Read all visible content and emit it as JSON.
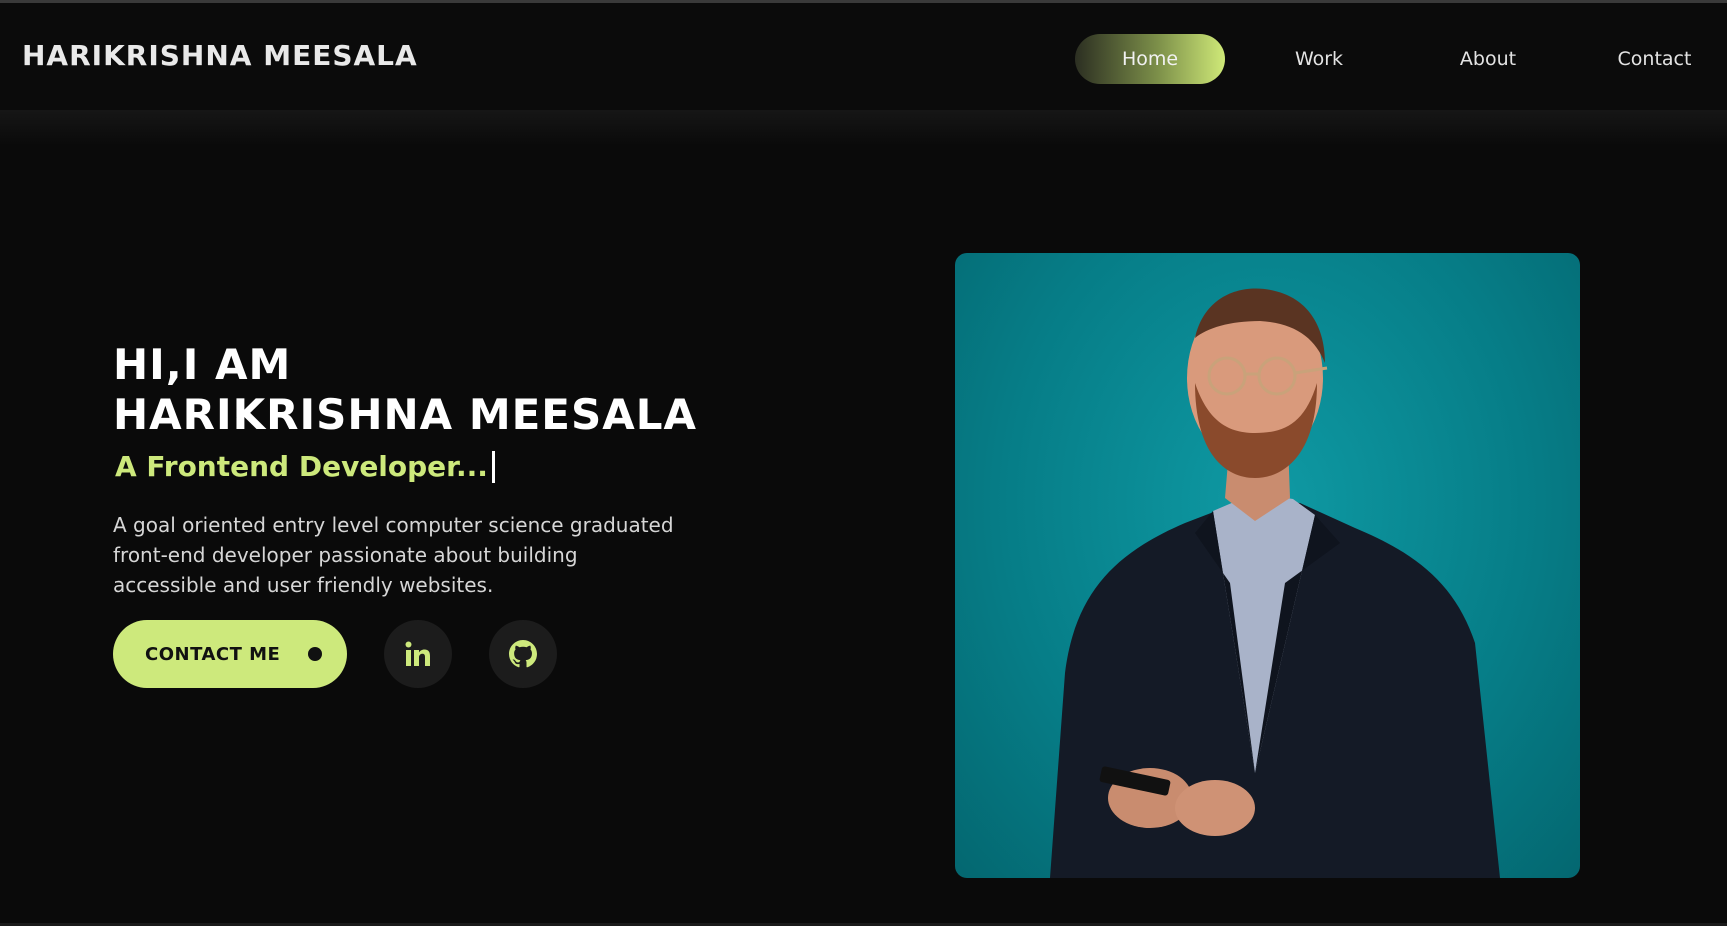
{
  "brand": "HARIKRISHNA MEESALA",
  "nav": {
    "home": "Home",
    "work": "Work",
    "about": "About",
    "contact": "Contact"
  },
  "hero": {
    "greeting_line1": "HI,I AM",
    "greeting_line2": "HARIKRISHNA MEESALA",
    "role": "A Frontend Developer...",
    "description_line1": "A goal oriented entry level computer science graduated",
    "description_line2": "front-end developer passionate about building",
    "description_line3": "accessible and user friendly websites.",
    "contact_button": "CONTACT ME"
  },
  "social": {
    "linkedin_icon": "linkedin-icon",
    "github_icon": "github-icon"
  },
  "colors": {
    "background": "#0a0a0a",
    "accent": "#cde97c",
    "portrait_background": "#067d87"
  }
}
